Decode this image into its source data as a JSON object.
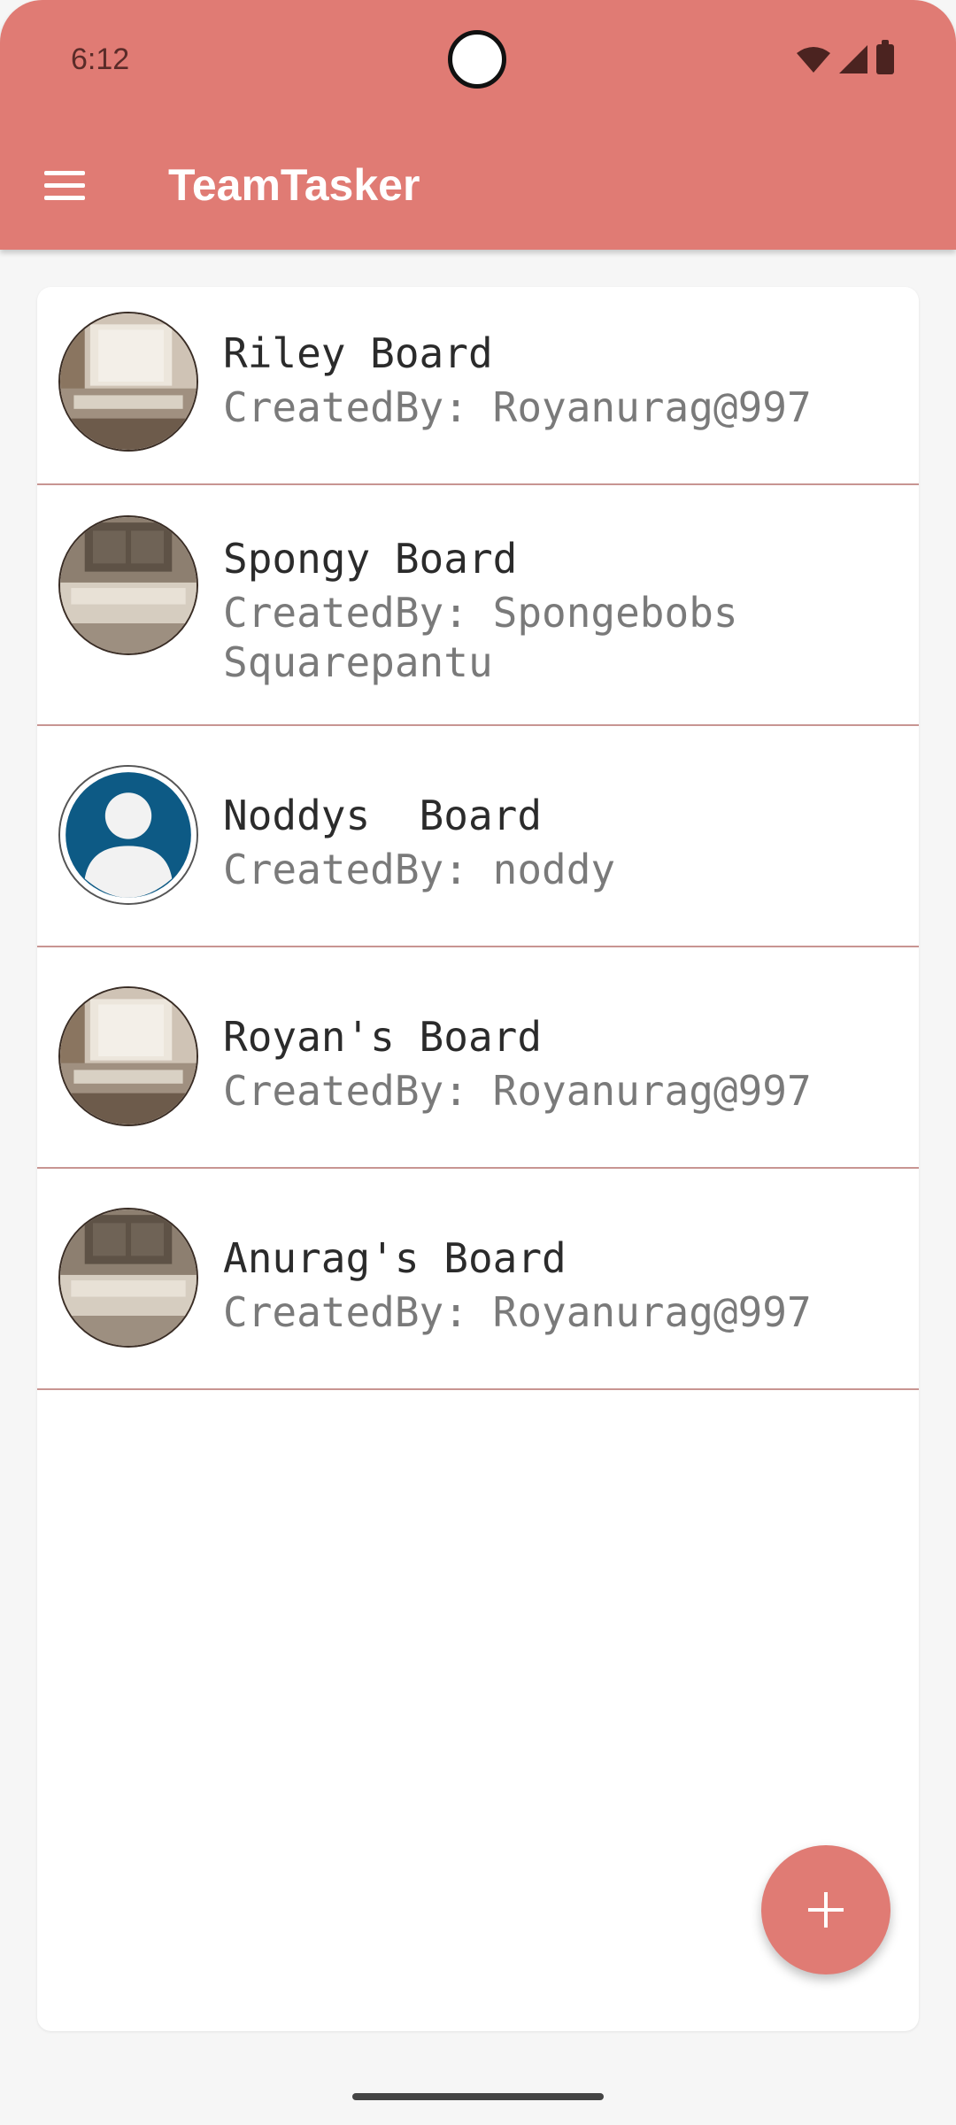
{
  "status_bar": {
    "time": "6:12"
  },
  "app_bar": {
    "title": "TeamTasker"
  },
  "boards": [
    {
      "name": "Riley Board",
      "created_by": "CreatedBy: Royanurag@997",
      "avatar": "living-room-photo"
    },
    {
      "name": "Spongy Board",
      "created_by": "CreatedBy: Spongebobs Squarepantu",
      "avatar": "sofa-room-photo"
    },
    {
      "name": "Noddys  Board",
      "created_by": "CreatedBy: noddy",
      "avatar": "default-user-icon"
    },
    {
      "name": "Royan's Board",
      "created_by": "CreatedBy: Royanurag@997",
      "avatar": "living-room-photo"
    },
    {
      "name": "Anurag's Board",
      "created_by": "CreatedBy: Royanurag@997",
      "avatar": "sofa-room-photo"
    }
  ],
  "fab": {
    "icon": "plus-icon"
  },
  "colors": {
    "accent": "#e07b74",
    "divider": "#c89592",
    "avatar_default": "#0d5a85"
  }
}
